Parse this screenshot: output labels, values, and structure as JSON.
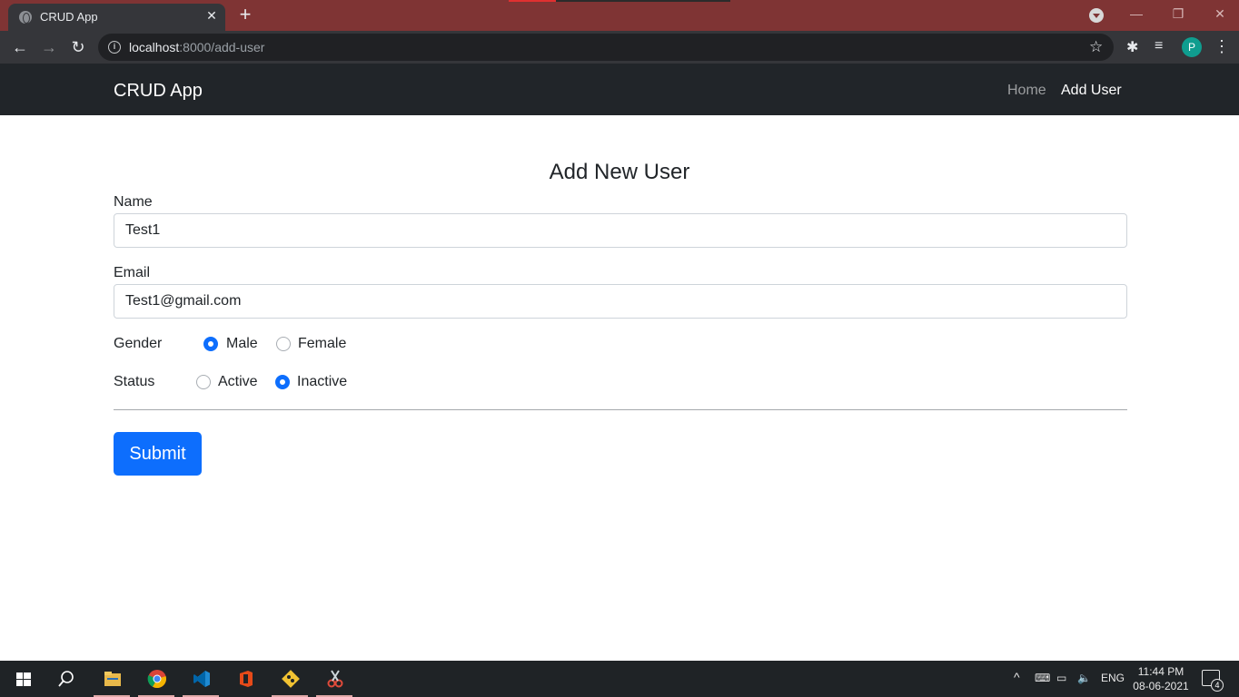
{
  "browser": {
    "tab_title": "CRUD App",
    "url_host": "localhost",
    "url_path": ":8000/add-user",
    "profile_initial": "P"
  },
  "navbar": {
    "brand": "CRUD App",
    "links": [
      {
        "label": "Home",
        "active": false
      },
      {
        "label": "Add User",
        "active": true
      }
    ]
  },
  "form": {
    "heading": "Add New User",
    "name": {
      "label": "Name",
      "value": "Test1"
    },
    "email": {
      "label": "Email",
      "value": "Test1@gmail.com"
    },
    "gender": {
      "label": "Gender",
      "options": [
        {
          "label": "Male",
          "checked": true
        },
        {
          "label": "Female",
          "checked": false
        }
      ]
    },
    "status": {
      "label": "Status",
      "options": [
        {
          "label": "Active",
          "checked": false
        },
        {
          "label": "Inactive",
          "checked": true
        }
      ]
    },
    "submit_label": "Submit"
  },
  "taskbar": {
    "apps": [
      "start-icon",
      "search-icon",
      "file-explorer-icon",
      "chrome-icon",
      "vscode-icon",
      "office-icon",
      "git-icon",
      "snipping-tool-icon"
    ],
    "language": "ENG",
    "time": "11:44 PM",
    "date": "08-06-2021",
    "notification_count": "4"
  },
  "colors": {
    "primary": "#0d6efd",
    "navbar_bg": "#212529",
    "titlebar": "#7f3434"
  }
}
